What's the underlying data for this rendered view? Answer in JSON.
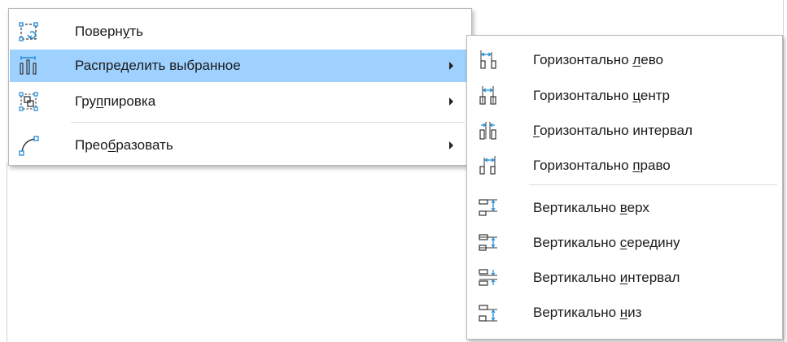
{
  "main_menu": {
    "items": [
      {
        "icon": "rotate-icon",
        "pre": "Поверн",
        "key": "у",
        "post": "ть",
        "has_submenu": false
      },
      {
        "icon": "distribute-icon",
        "pre": "Распре",
        "key": "д",
        "post": "елить выбранное",
        "has_submenu": true,
        "highlighted": true
      },
      {
        "icon": "group-icon",
        "pre": "Гру",
        "key": "п",
        "post": "пировка",
        "has_submenu": true
      },
      {
        "icon": "convert-curve-icon",
        "pre": "Прео",
        "key": "б",
        "post": "разовать",
        "has_submenu": true
      }
    ]
  },
  "submenu": {
    "items": [
      {
        "icon": "distribute-horizontal-left-icon",
        "pre": "Горизонтально ",
        "key": "л",
        "post": "ево"
      },
      {
        "icon": "distribute-horizontal-center-icon",
        "pre": "Горизонтально ",
        "key": "ц",
        "post": "ентр"
      },
      {
        "icon": "distribute-horizontal-spacing-icon",
        "pre": "",
        "key": "Г",
        "post": "оризонтально интервал"
      },
      {
        "icon": "distribute-horizontal-right-icon",
        "pre": "Горизонтально ",
        "key": "п",
        "post": "раво"
      },
      {
        "icon": "distribute-vertical-top-icon",
        "pre": "Вертикально ",
        "key": "в",
        "post": "ерх"
      },
      {
        "icon": "distribute-vertical-center-icon",
        "pre": "Вертикально ",
        "key": "с",
        "post": "ередину"
      },
      {
        "icon": "distribute-vertical-spacing-icon",
        "pre": "Вертикально ",
        "key": "и",
        "post": "нтервал"
      },
      {
        "icon": "distribute-vertical-bottom-icon",
        "pre": "Вертикально ",
        "key": "н",
        "post": "из"
      }
    ]
  },
  "colors": {
    "highlight": "#9fd1ff",
    "icon_accent": "#1e8ad6",
    "icon_dark": "#333333"
  }
}
